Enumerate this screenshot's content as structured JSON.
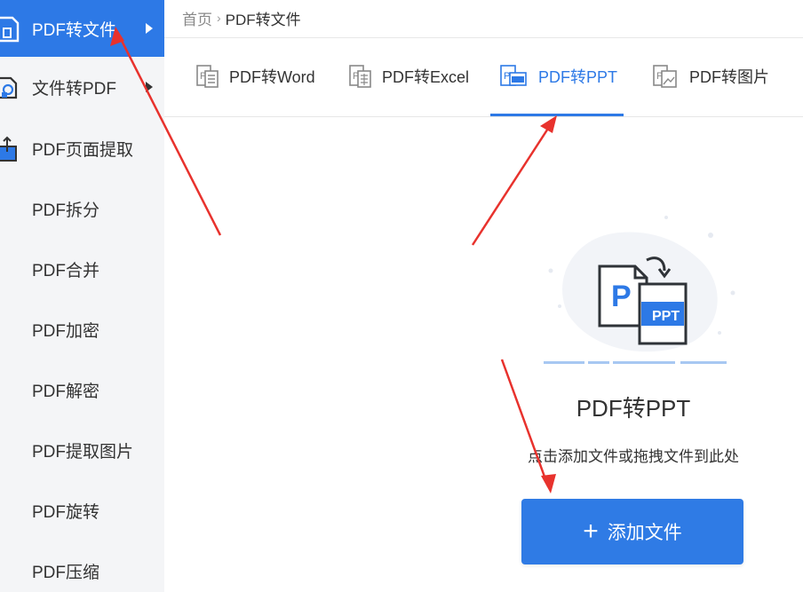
{
  "sidebar": {
    "items": [
      {
        "label": "PDF转文件",
        "active": true,
        "has_submenu": true
      },
      {
        "label": "文件转PDF",
        "active": false,
        "has_submenu": true
      },
      {
        "label": "PDF页面提取",
        "active": false,
        "has_submenu": false
      },
      {
        "label": "PDF拆分",
        "active": false,
        "has_submenu": false
      },
      {
        "label": "PDF合并",
        "active": false,
        "has_submenu": false
      },
      {
        "label": "PDF加密",
        "active": false,
        "has_submenu": false
      },
      {
        "label": "PDF解密",
        "active": false,
        "has_submenu": false
      },
      {
        "label": "PDF提取图片",
        "active": false,
        "has_submenu": false
      },
      {
        "label": "PDF旋转",
        "active": false,
        "has_submenu": false
      },
      {
        "label": "PDF压缩",
        "active": false,
        "has_submenu": false
      }
    ]
  },
  "breadcrumb": {
    "home": "首页",
    "separator": "›",
    "current": "PDF转文件"
  },
  "tabs": [
    {
      "label": "PDF转Word",
      "icon": "pdf-word-icon",
      "active": false
    },
    {
      "label": "PDF转Excel",
      "icon": "pdf-excel-icon",
      "active": false
    },
    {
      "label": "PDF转PPT",
      "icon": "pdf-ppt-icon",
      "active": true
    },
    {
      "label": "PDF转图片",
      "icon": "pdf-image-icon",
      "active": false
    }
  ],
  "dropzone": {
    "illustration_icon": "pdf-to-ppt-illustration",
    "illustration_p": "P",
    "illustration_ppt": "PPT",
    "title": "PDF转PPT",
    "hint": "点击添加文件或拖拽文件到此处",
    "button_plus": "+",
    "button_label": "添加文件"
  },
  "colors": {
    "accent": "#2d79e6",
    "sidebar_bg": "#f4f5f7",
    "annotation": "#e8322d"
  }
}
